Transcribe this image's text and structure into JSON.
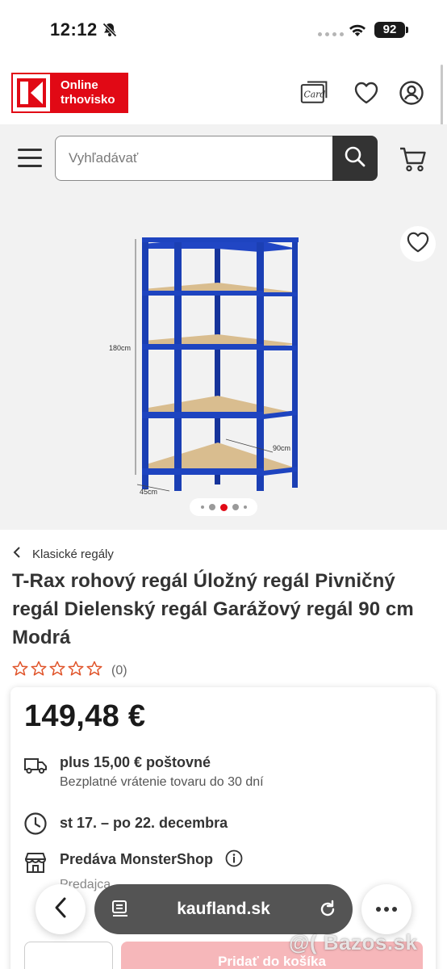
{
  "status_bar": {
    "time": "12:12",
    "battery": "92"
  },
  "header": {
    "logo_line1": "Online",
    "logo_line2": "trhovisko",
    "card_icon_text": "Card"
  },
  "search": {
    "placeholder": "Vyhľadávať"
  },
  "gallery": {
    "dimension_height": "180cm",
    "dimension_width": "90cm",
    "dimension_depth": "45cm",
    "active_slide_index": 3,
    "slide_dot_count": 5
  },
  "product": {
    "breadcrumb": "Klasické regály",
    "title": "T-Rax rohový regál Úložný regál Pivničný regál Dielenský regál Garážový regál 90 cm Modrá",
    "rating_count": "(0)",
    "rating_value": 0,
    "price": "149,48 €",
    "shipping": "plus 15,00 € poštovné",
    "returns": "Bezplatné vrátenie tovaru do 30 dní",
    "delivery": "st 17. – po 22. decembra",
    "seller": "Predáva MonsterShop",
    "seller_role": "Predajca",
    "add_to_cart": "Pridať do košíka"
  },
  "browser": {
    "host": "kaufland.sk"
  },
  "watermark": "@( Bazos.sk",
  "colors": {
    "brand_red": "#e10915",
    "dark": "#333333",
    "shelf_blue": "#1b3fb4",
    "shelf_board": "#d9b98a"
  }
}
